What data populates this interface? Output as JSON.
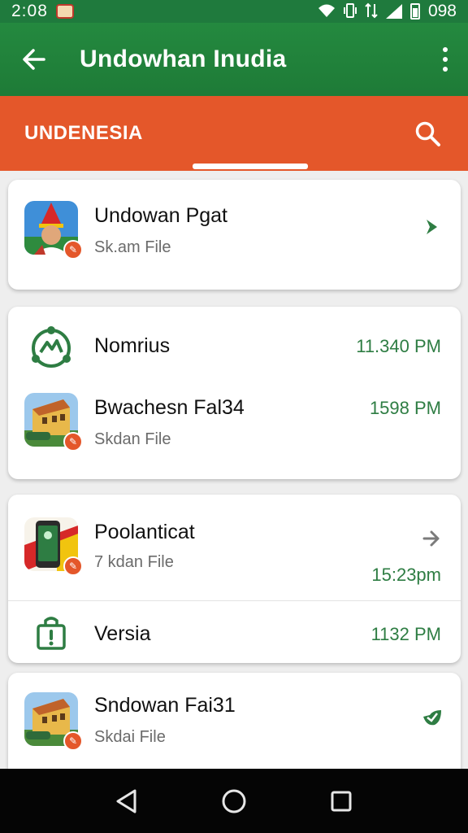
{
  "status_bar": {
    "time": "2:08",
    "battery": "098",
    "icons": [
      "notification-icon",
      "wifi-icon",
      "vibrate-icon",
      "signal-icon",
      "battery-icon"
    ]
  },
  "app_bar": {
    "title": "Undowhan Inudia",
    "icons": [
      "back-arrow-icon",
      "more-vert-icon"
    ],
    "color": "#1f7a3d"
  },
  "tab_bar": {
    "label": "UNDENESIA",
    "icon": "search-icon",
    "color": "#e4572a"
  },
  "cards": [
    {
      "items": [
        {
          "title": "Undowan Pgat",
          "subtitle": "Sk.am File",
          "time": "",
          "thumb": "person-portrait",
          "trailing_icon": "chevron-right-icon"
        }
      ]
    },
    {
      "items": [
        {
          "title": "Nomrius",
          "subtitle": "",
          "time": "11.340 PM",
          "thumb": "recycle-icon"
        },
        {
          "title": "Bwachesn Fal34",
          "subtitle": "Skdan File",
          "time": "1598 PM",
          "thumb": "building-photo"
        }
      ]
    },
    {
      "items": [
        {
          "title": "Poolanticat",
          "subtitle": "7 kdan File",
          "time": "15:23pm",
          "thumb": "phone-photo",
          "trailing_icon": "arrow-right-icon"
        },
        {
          "title": "Versia",
          "subtitle": "",
          "time": "1132 PM",
          "thumb": "lock-icon"
        }
      ]
    },
    {
      "items": [
        {
          "title": "Sndowan Fai31",
          "subtitle": "Skdai File",
          "time": "",
          "thumb": "building-photo",
          "trailing_icon": "check-leaf-icon"
        }
      ]
    }
  ],
  "accent": {
    "green": "#2e7d43",
    "orange": "#e4572a"
  },
  "nav_bar": {
    "buttons": [
      "back-triangle-icon",
      "home-circle-icon",
      "recents-square-icon"
    ]
  }
}
